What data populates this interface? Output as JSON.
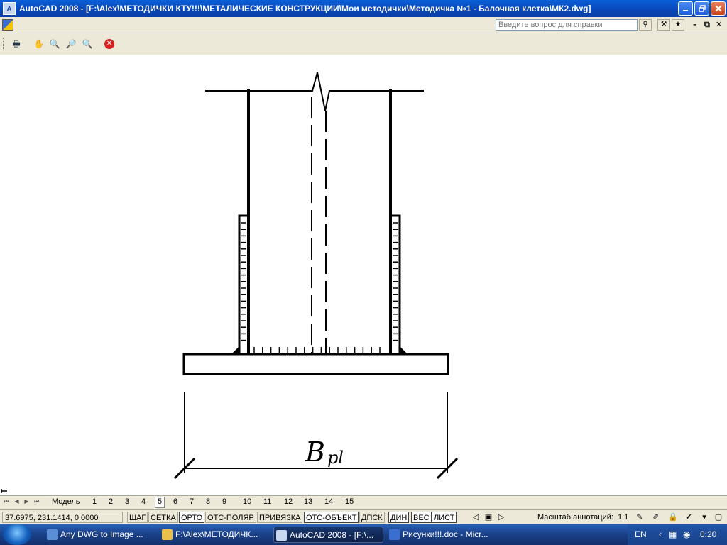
{
  "window": {
    "title": "AutoCAD 2008 - [F:\\Alex\\МЕТОДИЧКИ КТУ!!!\\МЕТАЛИЧЕСКИЕ КОНСТРУКЦИИ\\Мои методички\\Методичка №1 - Балочная клетка\\МК2.dwg]",
    "app_icon_glyph": "A"
  },
  "menubar": {
    "help_placeholder": "Введите вопрос для справки"
  },
  "drawing": {
    "dim_label_main": "B",
    "dim_label_sub": "pl"
  },
  "layout_tabs": {
    "model": "Модель",
    "layouts": [
      "1",
      "2",
      "3",
      "4",
      "5",
      "6",
      "7",
      "8",
      "9",
      "10",
      "11",
      "12",
      "13",
      "14",
      "15"
    ],
    "active": "5"
  },
  "statusbar": {
    "coords": "37.6975, 231.1414, 0.0000",
    "buttons": [
      {
        "label": "ШАГ",
        "on": false
      },
      {
        "label": "СЕТКА",
        "on": false
      },
      {
        "label": "ОРТО",
        "on": true
      },
      {
        "label": "ОТС-ПОЛЯР",
        "on": false
      },
      {
        "label": "ПРИВЯЗКА",
        "on": false
      },
      {
        "label": "ОТС-ОБЪЕКТ",
        "on": true
      },
      {
        "label": "ДПСК",
        "on": false
      },
      {
        "label": "ДИН",
        "on": true
      },
      {
        "label": "ВЕС",
        "on": true
      },
      {
        "label": "ЛИСТ",
        "on": true
      }
    ],
    "scale_label": "Масштаб аннотаций:",
    "scale_value": "1:1"
  },
  "taskbar": {
    "items": [
      {
        "label": "Any DWG to Image ...",
        "active": false,
        "color": "#5a8fd6"
      },
      {
        "label": "F:\\Alex\\МЕТОДИЧК...",
        "active": false,
        "color": "#e8c04a"
      },
      {
        "label": "AutoCAD 2008 - [F:\\...",
        "active": true,
        "color": "#c8d8f0"
      },
      {
        "label": "Рисунки!!!.doc - Micr...",
        "active": false,
        "color": "#3a6fcf"
      }
    ],
    "lang": "EN",
    "time": "0:20"
  },
  "colors": {
    "title_blue": "#0846b8",
    "chrome": "#ece9d8"
  }
}
